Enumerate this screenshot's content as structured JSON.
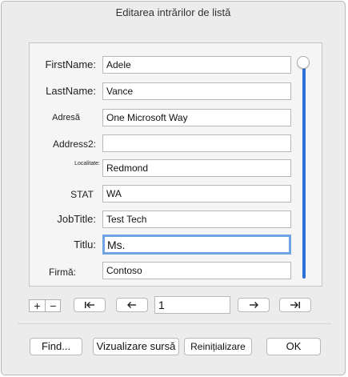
{
  "window": {
    "title": "Editarea intrărilor de listă"
  },
  "fields": [
    {
      "label": "FirstName:",
      "value": "Adele"
    },
    {
      "label": "LastName:",
      "value": "Vance"
    },
    {
      "label": "Adresă",
      "value": "One Microsoft Way"
    },
    {
      "label": "Address2:",
      "value": ""
    },
    {
      "label": "Localitate:",
      "value": "Redmond"
    },
    {
      "label": "STAT",
      "value": "WA"
    },
    {
      "label": "JobTitle:",
      "value": "Test Tech"
    },
    {
      "label": "Titlu:",
      "value": "Ms."
    },
    {
      "label": "Firmă:",
      "value": "Contoso"
    }
  ],
  "navigation": {
    "add_label": "+",
    "remove_label": "−",
    "record_number": "1",
    "icons": [
      "first-record-icon",
      "previous-record-icon",
      "next-record-icon",
      "last-record-icon"
    ]
  },
  "buttons": {
    "find": "Find...",
    "view_source": "Vizualizare sursă",
    "reset": "Reinițializare",
    "ok": "OK"
  },
  "colors": {
    "accent": "#2f6fd8",
    "focus_ring": "#6fa4e4",
    "dialog_bg": "#ececec"
  }
}
